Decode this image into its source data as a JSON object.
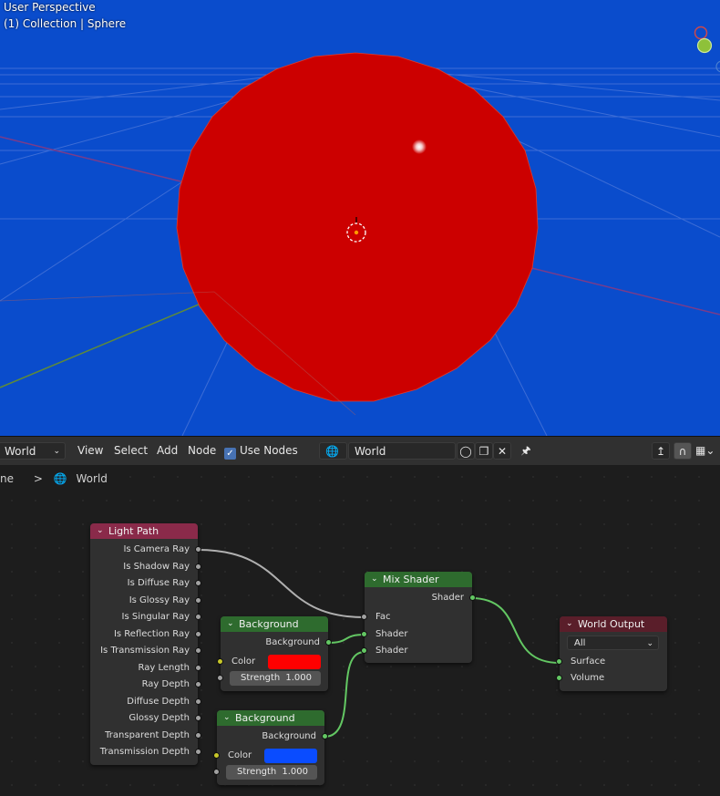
{
  "viewport": {
    "title": "User Perspective",
    "context": "(1) Collection | Sphere",
    "colors": {
      "world_background": "#0a4ccc",
      "sphere": "#cc0000"
    }
  },
  "header": {
    "editor_type": "World",
    "menus": [
      "View",
      "Select",
      "Add",
      "Node"
    ],
    "use_nodes_label": "Use Nodes",
    "use_nodes_checked": true,
    "datablock_name": "World"
  },
  "breadcrumb": {
    "partial": "ne",
    "separator": ">",
    "world": "World"
  },
  "nodes": {
    "light_path": {
      "title": "Light Path",
      "outputs": [
        "Is Camera Ray",
        "Is Shadow Ray",
        "Is Diffuse Ray",
        "Is Glossy Ray",
        "Is Singular Ray",
        "Is Reflection Ray",
        "Is Transmission Ray",
        "Ray Length",
        "Ray Depth",
        "Diffuse Depth",
        "Glossy Depth",
        "Transparent Depth",
        "Transmission Depth"
      ]
    },
    "background1": {
      "title": "Background",
      "output": "Background",
      "color_label": "Color",
      "color_value": "#ff0000",
      "strength_label": "Strength",
      "strength_value": "1.000"
    },
    "background2": {
      "title": "Background",
      "output": "Background",
      "color_label": "Color",
      "color_value": "#0a4cff",
      "strength_label": "Strength",
      "strength_value": "1.000"
    },
    "mix_shader": {
      "title": "Mix Shader",
      "output": "Shader",
      "inputs": [
        "Fac",
        "Shader",
        "Shader"
      ]
    },
    "world_output": {
      "title": "World Output",
      "target": "All",
      "inputs": [
        "Surface",
        "Volume"
      ]
    }
  }
}
